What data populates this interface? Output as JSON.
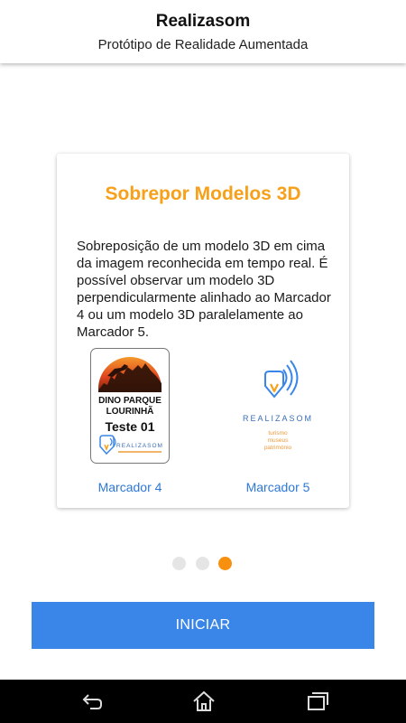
{
  "header": {
    "title": "Realizasom",
    "subtitle": "Protótipo de Realidade Aumentada"
  },
  "card": {
    "title": "Sobrepor Modelos 3D",
    "description": "Sobreposição de um modelo 3D em cima da imagem reconhecida em tempo real. É possível observar um modelo 3D perpendicularmente alinhado ao Marcador 4 ou um modelo 3D paralelamente ao Marcador 5.",
    "markers": [
      {
        "label": "Marcador 4",
        "image_text": [
          "DINO PARQUE",
          "LOURINHÃ",
          "Teste 01",
          "REALIZASOM"
        ]
      },
      {
        "label": "Marcador 5",
        "image_text": [
          "REALIZASOM",
          "turismo",
          "museus",
          "património"
        ]
      }
    ]
  },
  "pager": {
    "total": 3,
    "current": 3
  },
  "start_button": {
    "label": "INICIAR"
  },
  "icons": {
    "back": "back-icon",
    "home": "home-icon",
    "recents": "recents-icon"
  },
  "colors": {
    "accent_orange": "#f7a01a",
    "dot_active": "#f7900f",
    "dot_inactive": "#e5e5e5",
    "link_blue": "#2d78d6",
    "button_blue": "#3a86e8",
    "navbar": "#000000"
  }
}
